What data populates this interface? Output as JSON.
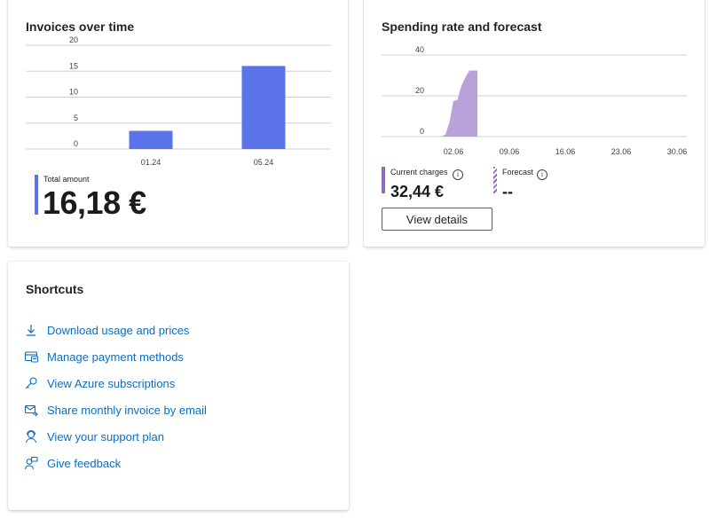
{
  "invoices": {
    "title": "Invoices over time",
    "total_label": "Total amount",
    "total_value": "16,18 €",
    "accent_color": "#5b73e8",
    "chart_data": {
      "type": "bar",
      "categories": [
        "01.24",
        "05.24"
      ],
      "values": [
        3.5,
        16
      ],
      "ylim": [
        0,
        20
      ],
      "yticks": [
        "0",
        "5",
        "10",
        "15",
        "20"
      ],
      "grid": true,
      "color": "#5b73e8"
    }
  },
  "spending": {
    "title": "Spending rate and forecast",
    "current_label": "Current charges",
    "current_value": "32,44 €",
    "forecast_label": "Forecast",
    "forecast_value": "--",
    "info_glyph": "i",
    "view_details_label": "View details",
    "accent_color": "#8e6bbf",
    "chart_data": {
      "type": "area",
      "x_ticks": [
        "02.06",
        "09.06",
        "16.06",
        "23.06",
        "30.06"
      ],
      "yticks": [
        "0",
        "20",
        "40"
      ],
      "ylim": [
        0,
        40
      ],
      "grid": true,
      "color": "#b9a2d9",
      "note_days": "x values are day-of-month in June",
      "x": [
        0.5,
        1,
        1.5,
        2,
        2.5,
        3,
        3.5,
        4,
        4.5,
        5
      ],
      "values": [
        0,
        1,
        7,
        17.5,
        18,
        25,
        29,
        32.4,
        32.4,
        32.4
      ]
    }
  },
  "shortcuts": {
    "title": "Shortcuts",
    "items": [
      {
        "label": "Download usage and prices",
        "icon": "download-icon"
      },
      {
        "label": "Manage payment methods",
        "icon": "payment-card-icon"
      },
      {
        "label": "View Azure subscriptions",
        "icon": "key-icon"
      },
      {
        "label": "Share monthly invoice by email",
        "icon": "mail-share-icon"
      },
      {
        "label": "View your support plan",
        "icon": "support-person-icon"
      },
      {
        "label": "Give feedback",
        "icon": "feedback-person-icon"
      }
    ],
    "link_color": "#0f6cbd"
  }
}
